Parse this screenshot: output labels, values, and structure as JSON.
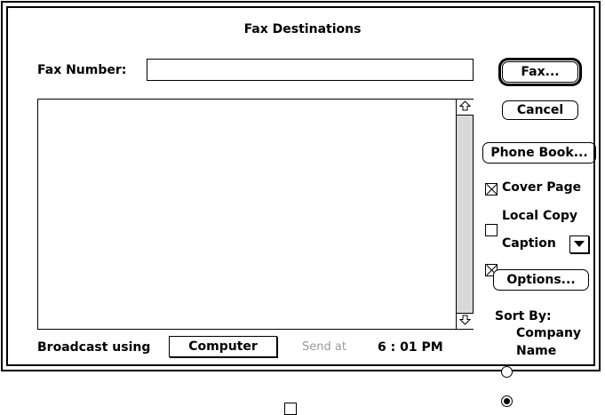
{
  "dialog": {
    "title": "Fax Destinations"
  },
  "fax_number": {
    "label": "Fax Number:",
    "value": ""
  },
  "buttons": {
    "fax": "Fax...",
    "cancel": "Cancel",
    "phone_book": "Phone Book...",
    "options": "Options...",
    "broadcast_value": "Computer"
  },
  "checkboxes": {
    "cover_page": {
      "label": "Cover Page",
      "checked": true
    },
    "local_copy": {
      "label": "Local Copy",
      "checked": false
    },
    "caption": {
      "label": "Caption",
      "checked": true
    },
    "send_at": {
      "label": "Send at",
      "checked": false
    }
  },
  "broadcast": {
    "label": "Broadcast using"
  },
  "send_time": "6 : 01 PM",
  "sort_by": {
    "label": "Sort By:",
    "options": [
      {
        "label": "Company",
        "selected": false
      },
      {
        "label": "Name",
        "selected": true
      }
    ]
  },
  "icons": {
    "scroll_up": "up-arrow-icon",
    "scroll_down": "down-arrow-icon",
    "caption_menu": "triangle-down-icon"
  }
}
